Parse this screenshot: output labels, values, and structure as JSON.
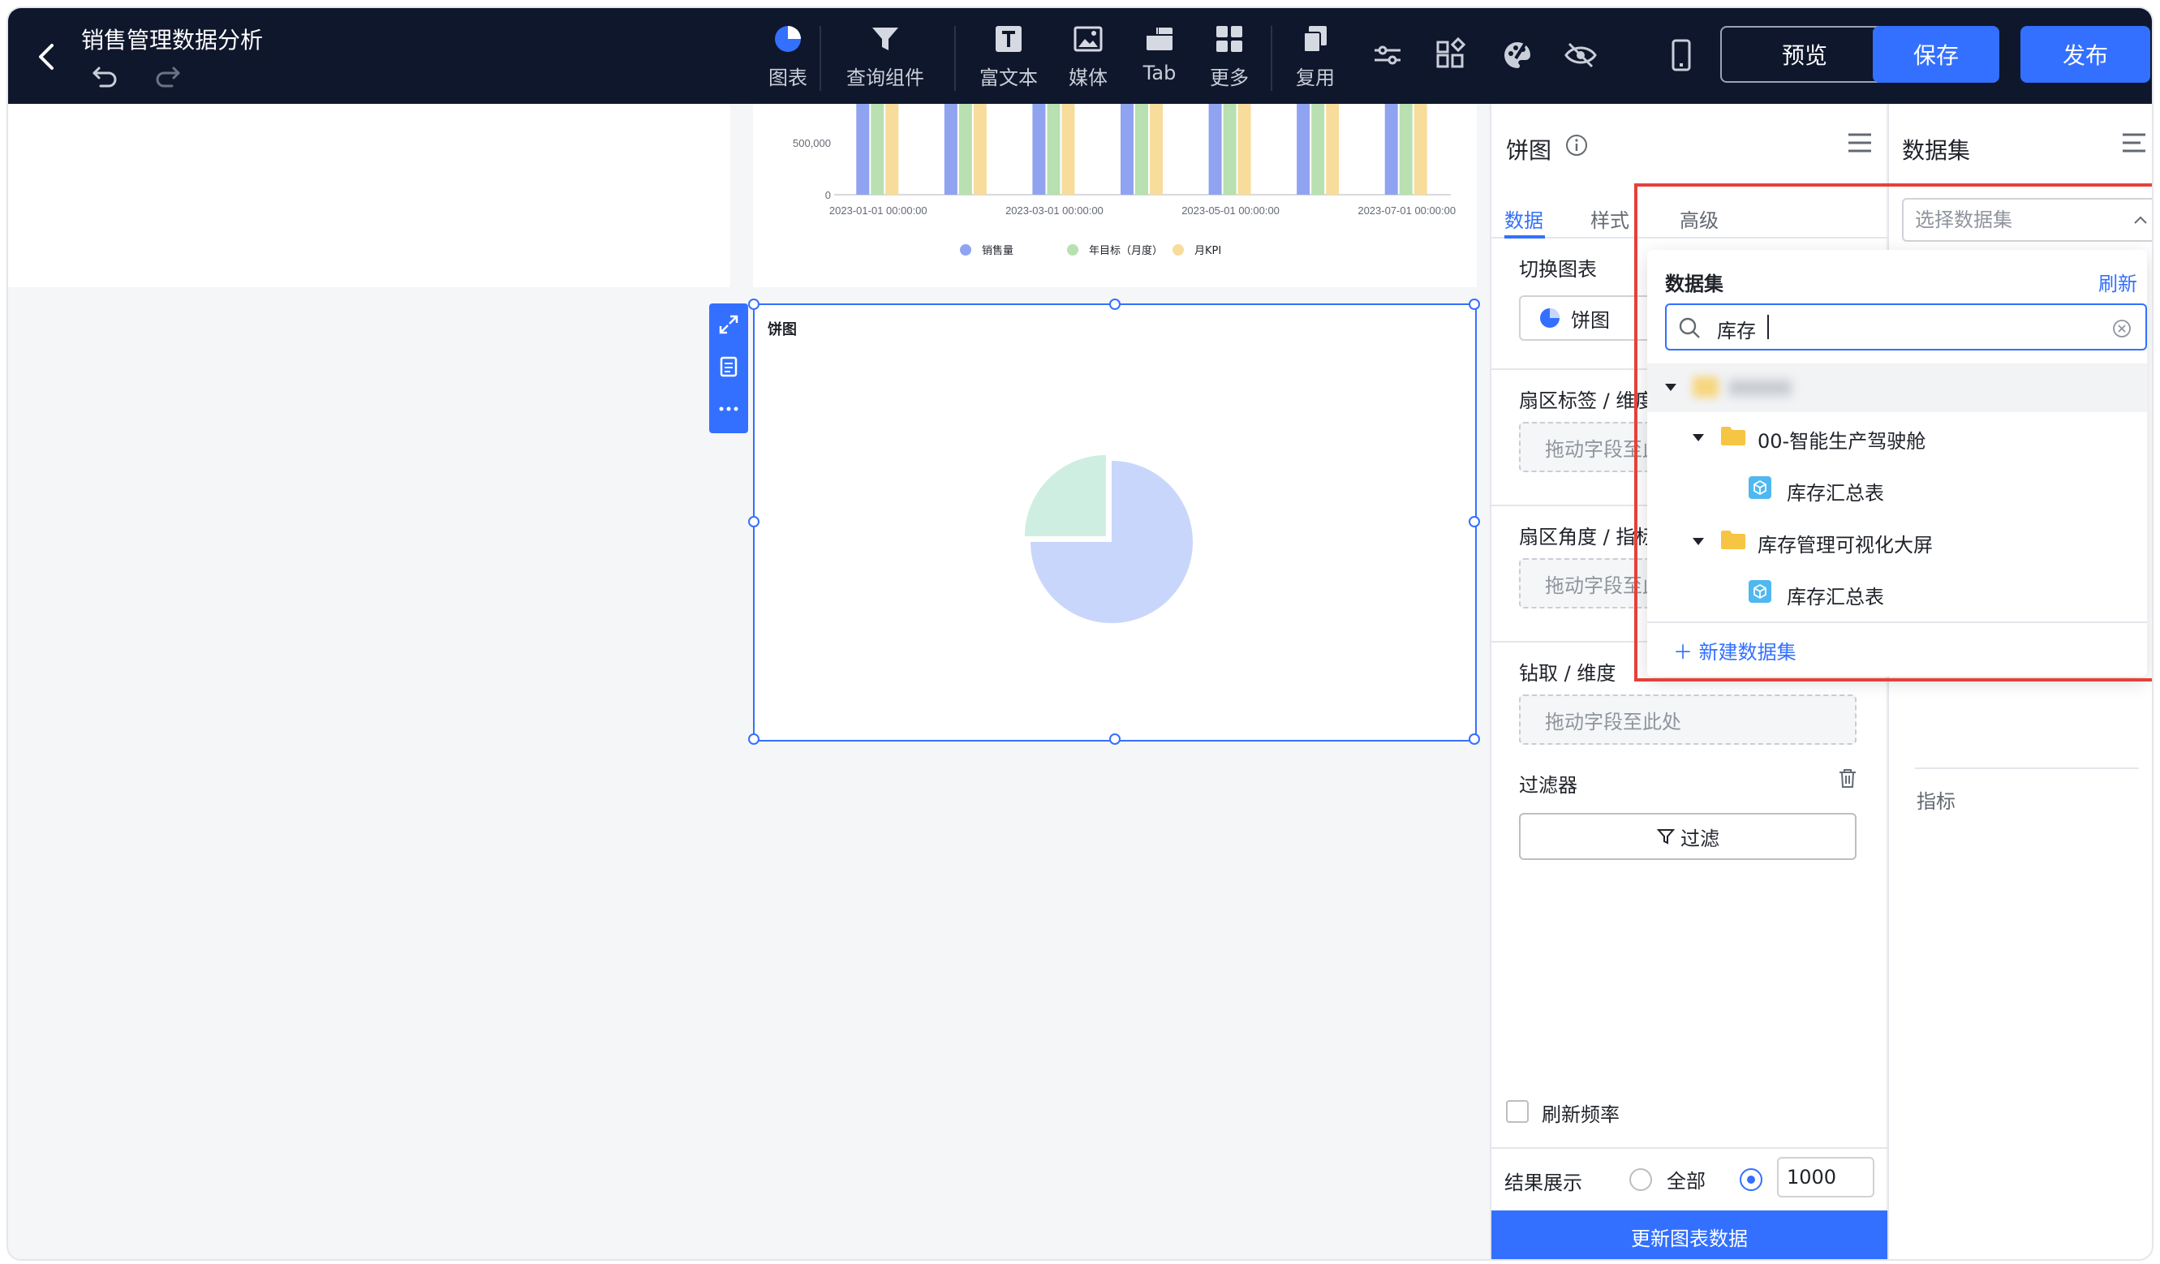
{
  "header": {
    "title": "销售管理数据分析",
    "tools": [
      {
        "label": "图表",
        "icon": "pie-chart-icon"
      },
      {
        "label": "查询组件",
        "icon": "funnel-icon"
      },
      {
        "label": "富文本",
        "icon": "text-icon"
      },
      {
        "label": "媒体",
        "icon": "image-icon"
      },
      {
        "label": "Tab",
        "icon": "tab-icon"
      },
      {
        "label": "更多",
        "icon": "grid-icon"
      },
      {
        "label": "复用",
        "icon": "copy-icon"
      }
    ],
    "preview_label": "预览",
    "save_label": "保存",
    "publish_label": "发布"
  },
  "canvas": {
    "pie_card_title": "饼图",
    "bar_chart_data": {
      "type": "bar",
      "yticks": [
        "500,000",
        "0"
      ],
      "xticks": [
        "2023-01-01 00:00:00",
        "2023-03-01 00:00:00",
        "2023-05-01 00:00:00",
        "2023-07-01 00:00:00"
      ],
      "legend": [
        "销售量",
        "年目标（月度）",
        "月KPI"
      ],
      "colors": [
        "#8fa3f0",
        "#b8e0b0",
        "#f7dc9c"
      ]
    },
    "pie_chart_data": {
      "type": "pie",
      "values": [
        0.75,
        0.25
      ],
      "colors": [
        "#c9d6fb",
        "#cfeee2"
      ]
    }
  },
  "config": {
    "title": "饼图",
    "tabs": [
      "数据",
      "样式",
      "高级"
    ],
    "switch_chart_label": "切换图表",
    "chart_type_value": "饼图",
    "sector_label_label": "扇区标签 / 维度",
    "sector_angle_label": "扇区角度 / 指标",
    "drill_label": "钻取 / 维度",
    "drop_placeholder": "拖动字段至此处",
    "filter_label": "过滤器",
    "filter_button": "过滤",
    "refresh_rate_label": "刷新频率",
    "result_label": "结果展示",
    "result_all": "全部",
    "result_limit": "1000",
    "update_button": "更新图表数据"
  },
  "dataset_panel": {
    "title": "数据集",
    "select_placeholder": "选择数据集",
    "metric_label": "指标"
  },
  "dropdown": {
    "header": "数据集",
    "refresh": "刷新",
    "search_value": "库存",
    "tree": [
      {
        "level": 1,
        "type": "folder",
        "label": "00-智能生产驾驶舱"
      },
      {
        "level": 2,
        "type": "dataset",
        "label": "库存汇总表"
      },
      {
        "level": 1,
        "type": "folder",
        "label": "库存管理可视化大屏"
      },
      {
        "level": 2,
        "type": "dataset",
        "label": "库存汇总表"
      }
    ],
    "new_dataset": "新建数据集"
  },
  "colors": {
    "accent": "#3370ff",
    "header_bg": "#0f172c",
    "highlight_box": "#e5413a"
  }
}
